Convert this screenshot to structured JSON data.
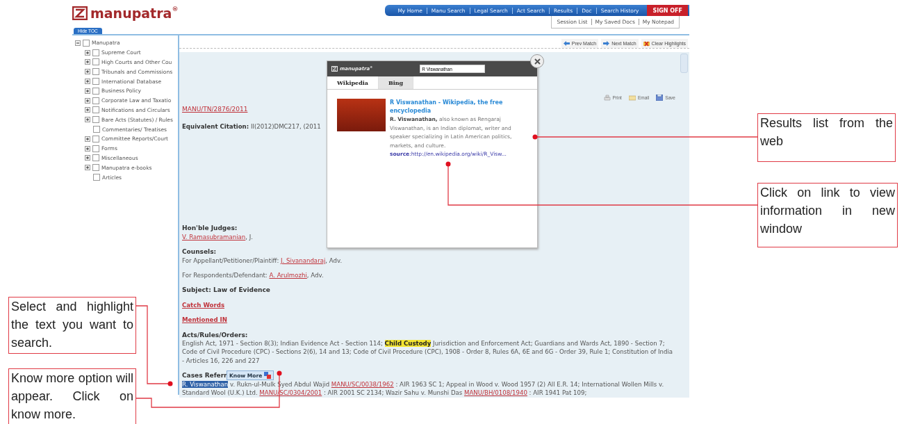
{
  "logo": {
    "text": "manupatra$^{®}$"
  },
  "nav": {
    "items": [
      "My Home",
      "Manu Search",
      "Legal Search",
      "Act Search",
      "Results",
      "Doc",
      "Search History"
    ],
    "sign_off": "SIGN OFF",
    "sub_items": [
      "Session List",
      "My Saved Docs",
      "My Notepad"
    ]
  },
  "toc": {
    "hide_button": "Hide TOC",
    "tree": [
      {
        "label": "Manupatra",
        "checked": false,
        "expanded": true,
        "children": [
          {
            "label": "Supreme Court",
            "checked": false,
            "expanded": false
          },
          {
            "label": "High Courts and Other Cou",
            "checked": false,
            "expanded": false
          },
          {
            "label": "Tribunals and Commissions",
            "checked": false,
            "expanded": false
          },
          {
            "label": "International Database",
            "checked": false,
            "expanded": false
          },
          {
            "label": "Business Policy",
            "checked": false,
            "expanded": false
          },
          {
            "label": "Corporate Law and Taxatio",
            "checked": false,
            "expanded": false
          },
          {
            "label": "Notifications and Circulars",
            "checked": false,
            "expanded": false
          },
          {
            "label": "Bare Acts (Statutes) / Rules",
            "checked": false,
            "expanded": false
          },
          {
            "label": "Commentaries/ Treatises",
            "checked": false
          },
          {
            "label": "Committee Reports/Court",
            "checked": false,
            "expanded": false
          },
          {
            "label": "Forms",
            "checked": false,
            "expanded": false
          },
          {
            "label": "Miscellaneous",
            "checked": false,
            "expanded": false
          },
          {
            "label": "Manupatra e-books",
            "checked": false,
            "expanded": false
          },
          {
            "label": "Articles",
            "checked": false
          }
        ]
      }
    ]
  },
  "toolbar": [
    "Prev Match",
    "Next Match",
    "Clear Highlights"
  ],
  "doc_actions": [
    "Print",
    "Email",
    "Save"
  ],
  "document": {
    "citation_link": "MANU/TN/2876/2011",
    "equivalent_label": "Equivalent Citation:",
    "equivalent_value": "II(2012)DMC217, (2011",
    "blocks": [
      {
        "title": "Hon'ble Judges:",
        "lines": [
          [
            {
              "kind": "link",
              "text": "V. Ramasubramanian"
            },
            {
              "kind": "plain",
              "text": ", J."
            }
          ]
        ]
      },
      {
        "title": "Counsels:",
        "lines": [
          [
            {
              "kind": "plain",
              "text": "For Appellant/Petitioner/Plaintiff: "
            },
            {
              "kind": "link",
              "text": "J. Sivanandaraj"
            },
            {
              "kind": "plain",
              "text": ", Adv."
            }
          ]
        ]
      },
      {
        "lines": [
          [
            {
              "kind": "plain",
              "text": "For Respondents/Defendant: "
            },
            {
              "kind": "link",
              "text": "A. Arulmozhi"
            },
            {
              "kind": "plain",
              "text": ", Adv."
            }
          ]
        ]
      },
      {
        "title": "Subject: Law of Evidence"
      },
      {
        "lines": [
          [
            {
              "kind": "heading_link",
              "text": "Catch Words"
            }
          ]
        ]
      },
      {
        "lines": [
          [
            {
              "kind": "heading_link",
              "text": "Mentioned IN"
            }
          ]
        ]
      },
      {
        "title": "Acts/Rules/Orders:",
        "lines": [
          [
            {
              "kind": "plain",
              "text": "English Act, 1971 - Section 8(3); Indian Evidence Act - Section 114; "
            },
            {
              "kind": "mark",
              "text": "Child Custody"
            },
            {
              "kind": "plain",
              "text": " Jurisdiction and Enforcement Act; Guardians and Wards Act, 1890 - Section 7; Code of Civil Procedure (CPC) - Sections 2(6), 14 and 13; Code of Civil Procedure (CPC), 1908 - Order 8, Rules 6A, 6E and 6G - Order 39, Rule 1; Constitution of India - Articles 16, 226 and 227"
            }
          ]
        ]
      },
      {
        "title": "Cases Referr",
        "lines": [
          [
            {
              "kind": "selected",
              "text": "R. Viswanathan"
            },
            {
              "kind": "plain",
              "text": " v. Rukn-ul-Mulk Syed Abdul Wajid "
            },
            {
              "kind": "link",
              "text": "MANU/SC/0038/1962"
            },
            {
              "kind": "plain",
              "text": " : AIR 1963 SC 1; Appeal in Wood v. Wood 1957 (2) All E.R. 14; International Wollen Mills v. Standard Wool (U.K.) Ltd. "
            },
            {
              "kind": "link",
              "text": "MANU/SC/0304/2001"
            },
            {
              "kind": "plain",
              "text": " : AIR 2001 SC 2134; Wazir Sahu v. Munshi Das "
            },
            {
              "kind": "link",
              "text": "MANU/BH/0108/1940"
            },
            {
              "kind": "plain",
              "text": " : AIR 1941 Pat 109;"
            }
          ]
        ]
      }
    ]
  },
  "know_more": "Know More",
  "popup": {
    "logo": "manupatra$^{®}$",
    "query": "R Viswanathan",
    "tabs": [
      {
        "label": "Wikipedia",
        "selected": true
      },
      {
        "label": "Bing",
        "selected": false
      }
    ],
    "result": {
      "title": "R Viswanathan - Wikipedia, the free encyclopedia",
      "snippet": "**R. Viswanathan,** also known as Rengaraj Viswanathan, is an Indian diplomat, writer and speaker specializing in Latin American politics, markets, and culture.",
      "source": "**source**:http://en.wikipedia.org/wiki/R_Visw..."
    }
  },
  "callouts": [
    {
      "text": "Results list from the web"
    },
    {
      "text": "Click on link to view information in new window"
    },
    {
      "text": "Select and highlight the text you want to search."
    },
    {
      "text": "Know more option will appear. Click on know more."
    }
  ]
}
